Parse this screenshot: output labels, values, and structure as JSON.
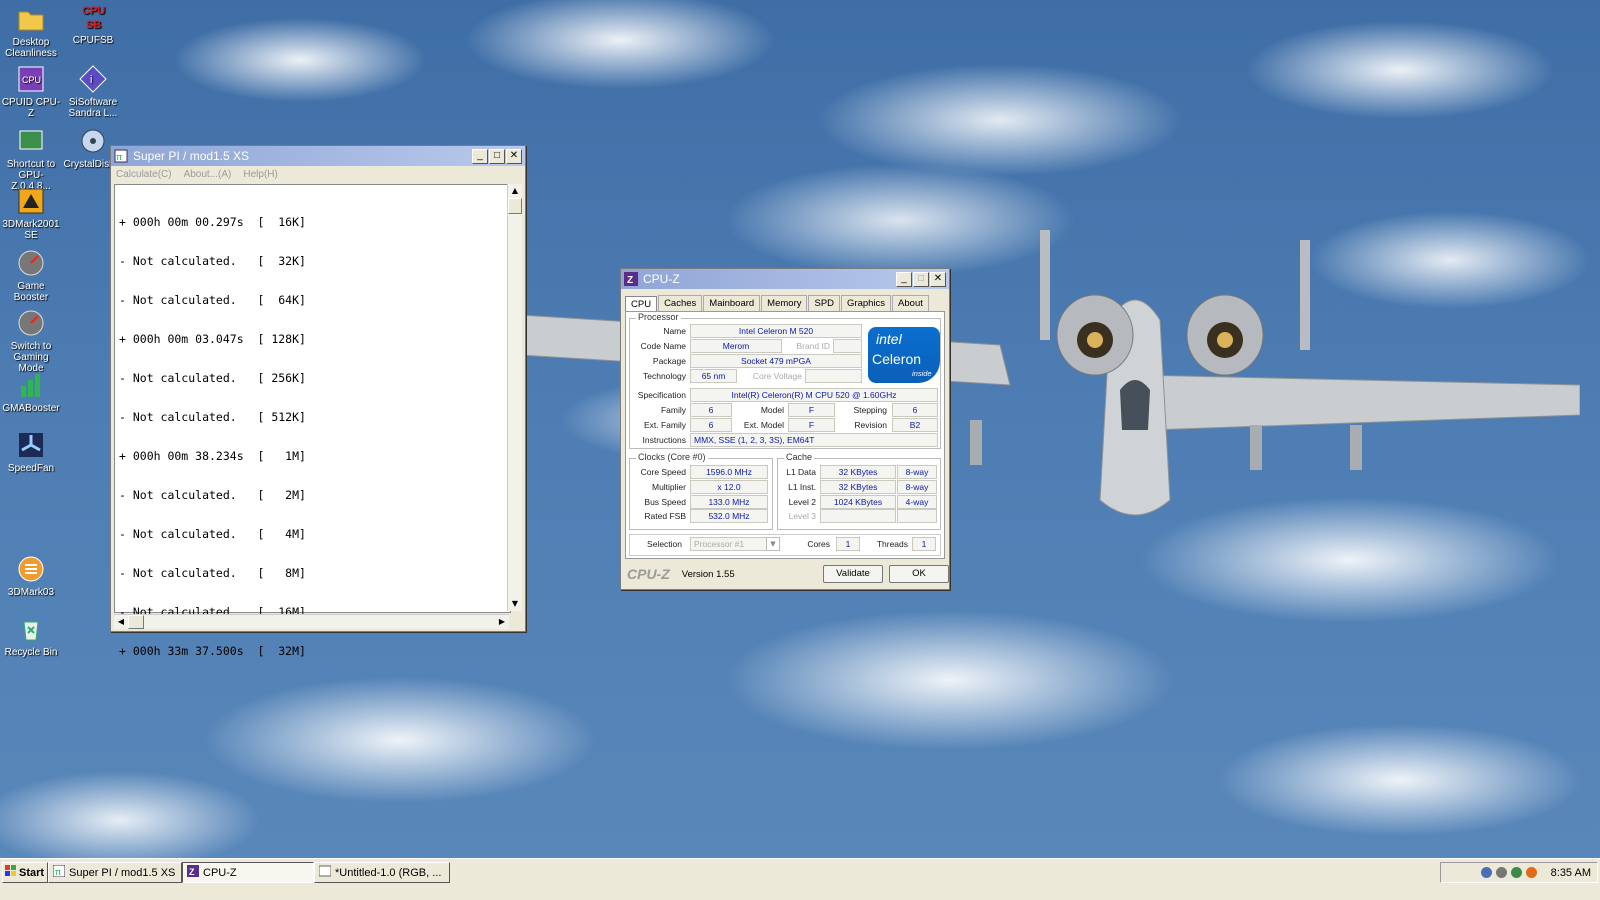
{
  "desktop": {
    "icons": [
      {
        "label": "Desktop\nCleanliness"
      },
      {
        "label": "CPUFSB"
      },
      {
        "label": "CPUID CPU-Z"
      },
      {
        "label": "SiSoftware\nSandra L..."
      },
      {
        "label": "Shortcut to\nGPU-Z.0.4.8..."
      },
      {
        "label": "CrystalDisk..."
      },
      {
        "label": "3DMark2001\nSE"
      },
      {
        "label": "Game Booster"
      },
      {
        "label": "Switch to\nGaming Mode"
      },
      {
        "label": "GMABooster"
      },
      {
        "label": "SpeedFan"
      },
      {
        "label": "3DMark03"
      },
      {
        "label": "Recycle Bin"
      }
    ]
  },
  "superpi": {
    "title": "Super PI / mod1.5 XS",
    "menu": [
      "Calculate(C)",
      "About...(A)",
      "Help(H)"
    ],
    "results": [
      "+ 000h 00m 00.297s  [  16K]",
      "- Not calculated.   [  32K]",
      "- Not calculated.   [  64K]",
      "+ 000h 00m 03.047s  [ 128K]",
      "- Not calculated.   [ 256K]",
      "- Not calculated.   [ 512K]",
      "+ 000h 00m 38.234s  [   1M]",
      "- Not calculated.   [   2M]",
      "- Not calculated.   [   4M]",
      "- Not calculated.   [   8M]",
      "- Not calculated.   [  16M]",
      "+ 000h 33m 37.500s  [  32M]"
    ]
  },
  "cpuz": {
    "title": "CPU-Z",
    "tabs": [
      "CPU",
      "Caches",
      "Mainboard",
      "Memory",
      "SPD",
      "Graphics",
      "About"
    ],
    "processor": {
      "group": "Processor",
      "name_label": "Name",
      "name": "Intel Celeron M 520",
      "codename_label": "Code Name",
      "codename": "Merom",
      "brandid_label": "Brand ID",
      "package_label": "Package",
      "package": "Socket 479 mPGA",
      "technology_label": "Technology",
      "technology": "65 nm",
      "corevoltage_label": "Core Voltage",
      "spec_label": "Specification",
      "spec": "Intel(R) Celeron(R) M CPU       520  @ 1.60GHz",
      "family_label": "Family",
      "family": "6",
      "model_label": "Model",
      "model": "F",
      "stepping_label": "Stepping",
      "stepping": "6",
      "extfamily_label": "Ext. Family",
      "extfamily": "6",
      "extmodel_label": "Ext. Model",
      "extmodel": "F",
      "revision_label": "Revision",
      "revision": "B2",
      "instructions_label": "Instructions",
      "instructions": "MMX, SSE (1, 2, 3, 3S), EM64T",
      "logo_line1": "intel",
      "logo_line2": "Celeron",
      "logo_line3": "inside"
    },
    "clocks": {
      "group": "Clocks (Core #0)",
      "corespeed_label": "Core Speed",
      "corespeed": "1596.0 MHz",
      "multiplier_label": "Multiplier",
      "multiplier": "x 12.0",
      "busspeed_label": "Bus Speed",
      "busspeed": "133.0 MHz",
      "ratedfsb_label": "Rated FSB",
      "ratedfsb": "532.0 MHz"
    },
    "cache": {
      "group": "Cache",
      "l1data_label": "L1 Data",
      "l1data": "32 KBytes",
      "l1data_way": "8-way",
      "l1inst_label": "L1 Inst.",
      "l1inst": "32 KBytes",
      "l1inst_way": "8-way",
      "level2_label": "Level 2",
      "level2": "1024 KBytes",
      "level2_way": "4-way",
      "level3_label": "Level 3"
    },
    "selection_label": "Selection",
    "selection": "Processor #1",
    "cores_label": "Cores",
    "cores": "1",
    "threads_label": "Threads",
    "threads": "1",
    "brand": "CPU-Z",
    "version": "Version 1.55",
    "validate": "Validate",
    "ok": "OK"
  },
  "taskbar": {
    "start": "Start",
    "tasks": [
      "Super PI / mod1.5 XS",
      "CPU-Z",
      "*Untitled-1.0 (RGB, ..."
    ],
    "clock": "8:35 AM"
  }
}
